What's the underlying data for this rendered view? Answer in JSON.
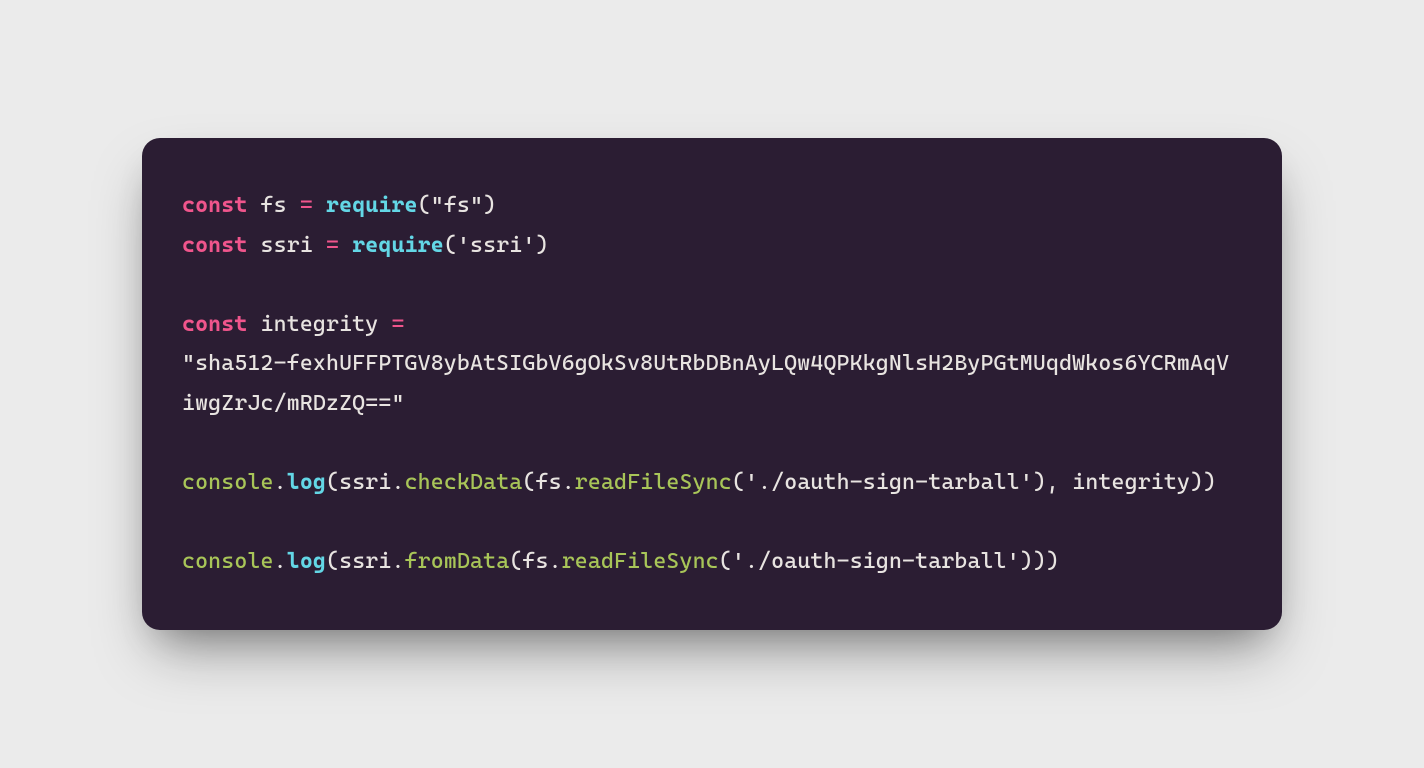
{
  "colors": {
    "background": "#ebebeb",
    "code_bg": "#2b1d33",
    "keyword": "#f0558c",
    "variable": "#e8e4e1",
    "function": "#63d7e6",
    "call": "#a8c558",
    "string": "#e8e4e1"
  },
  "code": {
    "line1": {
      "kw": "const",
      "var": "fs",
      "op": "=",
      "fn": "require",
      "open": "(",
      "str": "\"fs\"",
      "close": ")"
    },
    "line2": {
      "kw": "const",
      "var": "ssri",
      "op": "=",
      "fn": "require",
      "open": "(",
      "str": "'ssri'",
      "close": ")"
    },
    "line4": {
      "kw": "const",
      "var": "integrity",
      "op": "="
    },
    "line5": {
      "str": "\"sha512-fexhUFFPTGV8ybAtSIGbV6gOkSv8UtRbDBnAyLQw4QPKkgNlsH2ByPGtMUqdWkos6YCRmAqViwgZrJc/mRDzZQ==\""
    },
    "line7": {
      "obj1": "console",
      "dot1": ".",
      "prop1": "log",
      "open1": "(",
      "obj2": "ssri",
      "dot2": ".",
      "method1": "checkData",
      "open2": "(",
      "obj3": "fs",
      "dot3": ".",
      "method2": "readFileSync",
      "open3": "(",
      "str": "'./oauth-sign-tarball'",
      "close3": ")",
      "comma": ", ",
      "arg": "integrity",
      "close2": ")",
      "close1": ")"
    },
    "line9": {
      "obj1": "console",
      "dot1": ".",
      "prop1": "log",
      "open1": "(",
      "obj2": "ssri",
      "dot2": ".",
      "method1": "fromData",
      "open2": "(",
      "obj3": "fs",
      "dot3": ".",
      "method2": "readFileSync",
      "open3": "(",
      "str": "'./oauth-sign-tarball'",
      "close3": ")",
      "close2": ")",
      "close1": ")"
    }
  }
}
